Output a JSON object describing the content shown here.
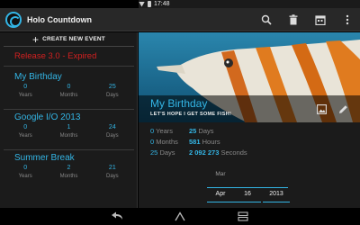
{
  "statusbar": {
    "time": "17:48"
  },
  "app": {
    "title": "Holo Countdown"
  },
  "actions": {
    "search_icon": "search-icon",
    "delete_icon": "delete-icon",
    "calendar_icon": "calendar-icon",
    "overflow_icon": "overflow-menu-icon"
  },
  "left": {
    "create_label": "CREATE NEW EVENT",
    "expired_label": "Release 3.0 - Expired",
    "events": [
      {
        "title": "My Birthday",
        "values": [
          {
            "num": "0",
            "unit": "Years"
          },
          {
            "num": "0",
            "unit": "Months"
          },
          {
            "num": "25",
            "unit": "Days"
          }
        ]
      },
      {
        "title": "Google I/O 2013",
        "values": [
          {
            "num": "0",
            "unit": "Years"
          },
          {
            "num": "1",
            "unit": "Months"
          },
          {
            "num": "24",
            "unit": "Days"
          }
        ]
      },
      {
        "title": "Summer Break",
        "values": [
          {
            "num": "0",
            "unit": "Years"
          },
          {
            "num": "2",
            "unit": "Months"
          },
          {
            "num": "21",
            "unit": "Days"
          }
        ]
      }
    ]
  },
  "detail": {
    "title": "My Birthday",
    "subtitle": "LET'S HOPE I GET SOME FISH!",
    "stats": {
      "years_num": "0",
      "years_unit": "Years",
      "months_num": "0",
      "months_unit": "Months",
      "days_num": "25",
      "days_unit": "Days",
      "days2_num": "25",
      "days2_unit": "Days",
      "hours_num": "581",
      "hours_unit": "Hours",
      "seconds_num": "2 092 273",
      "seconds_unit": "Seconds"
    },
    "date_picker": {
      "month_above": "Mar",
      "month": "Apr",
      "day": "16",
      "year": "2013"
    }
  },
  "colors": {
    "accent": "#33b5e5",
    "expired": "#d32020",
    "background": "#1b1b1b"
  }
}
